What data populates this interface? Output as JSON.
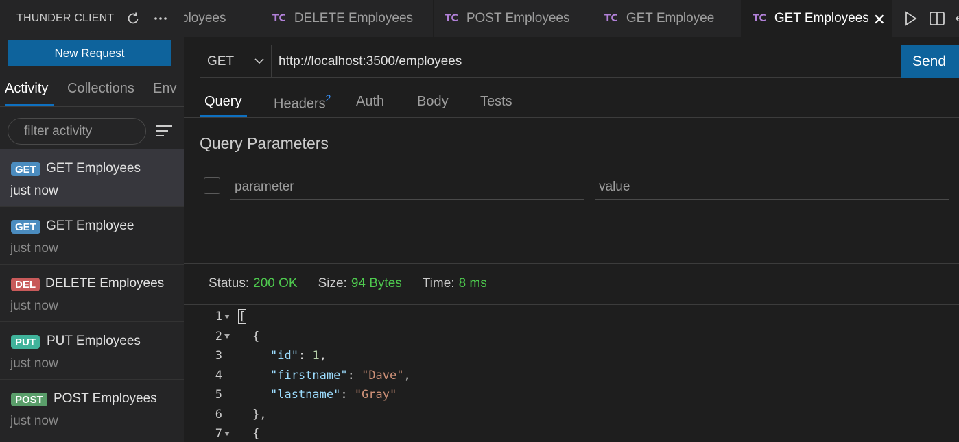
{
  "sidebar": {
    "title": "THUNDER CLIENT",
    "new_request": "New Request",
    "tabs": [
      "Activity",
      "Collections",
      "Env"
    ],
    "filter_placeholder": "filter activity",
    "activity": [
      {
        "method": "GET",
        "name": "GET Employees",
        "time": "just now",
        "color": "#4b8cbf"
      },
      {
        "method": "GET",
        "name": "GET Employee",
        "time": "just now",
        "color": "#4b8cbf"
      },
      {
        "method": "DEL",
        "name": "DELETE Employees",
        "time": "just now",
        "color": "#c85a5a"
      },
      {
        "method": "PUT",
        "name": "PUT Employees",
        "time": "just now",
        "color": "#40b39b"
      },
      {
        "method": "POST",
        "name": "POST Employees",
        "time": "just now",
        "color": "#5a9e6a"
      }
    ]
  },
  "tabs": [
    {
      "label": "ployees",
      "prefix": ""
    },
    {
      "label": "DELETE Employees",
      "prefix": "TC"
    },
    {
      "label": "POST Employees",
      "prefix": "TC"
    },
    {
      "label": "GET Employee",
      "prefix": "TC"
    },
    {
      "label": "GET Employees",
      "prefix": "TC"
    }
  ],
  "request": {
    "method": "GET",
    "url": "http://localhost:3500/employees",
    "send": "Send",
    "tabs": [
      "Query",
      "Headers",
      "Auth",
      "Body",
      "Tests"
    ],
    "headers_count": "2",
    "query_title": "Query Parameters",
    "param_placeholder": "parameter",
    "value_placeholder": "value"
  },
  "response": {
    "status_label": "Status:",
    "status": "200 OK",
    "size_label": "Size:",
    "size": "94 Bytes",
    "time_label": "Time:",
    "time": "8 ms",
    "line_numbers": [
      "1",
      "2",
      "3",
      "4",
      "5",
      "6",
      "7"
    ],
    "code": {
      "l1": "[",
      "l2": "{",
      "l3_key": "\"id\"",
      "l3_val": "1",
      "l4_key": "\"firstname\"",
      "l4_val": "\"Dave\"",
      "l5_key": "\"lastname\"",
      "l5_val": "\"Gray\"",
      "l6": "},",
      "l7": "{"
    }
  }
}
